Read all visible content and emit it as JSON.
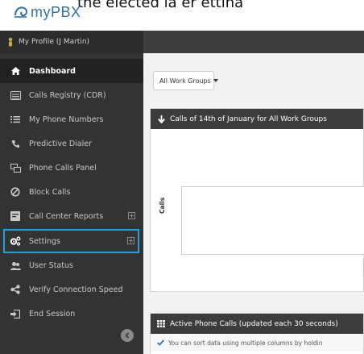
{
  "header": {
    "brand": "myPBX",
    "clipped_text": "the elected la er ettina"
  },
  "profile": {
    "label": "My Profile (J Martin)"
  },
  "sidebar": {
    "items": [
      {
        "label": "Dashboard",
        "icon": "home-icon",
        "active": true
      },
      {
        "label": "Calls Registry (CDR)",
        "icon": "registry-icon"
      },
      {
        "label": "My Phone Numbers",
        "icon": "list-icon"
      },
      {
        "label": "Predictive Dialer",
        "icon": "phone-icon"
      },
      {
        "label": "Phone Calls Panel",
        "icon": "panel-icon"
      },
      {
        "label": "Block Calls",
        "icon": "block-icon"
      },
      {
        "label": "Call Center Reports",
        "icon": "reports-icon",
        "expandable": true
      },
      {
        "label": "Settings",
        "icon": "gear-icon",
        "expandable": true,
        "highlighted": true
      },
      {
        "label": "User Status",
        "icon": "users-icon"
      },
      {
        "label": "Verify Connection Speed",
        "icon": "share-icon"
      },
      {
        "label": "End Session",
        "icon": "logout-icon"
      }
    ]
  },
  "main": {
    "workgroup_select": "All Work Groups",
    "calls_panel": {
      "title": "Calls of 14th of January for All Work Groups",
      "ylabel": "Calls"
    },
    "active_panel": {
      "title": "Active Phone Calls (updated each 30 seconds)",
      "info": "You can sort data using multiple columns by holdin"
    }
  },
  "colors": {
    "sidebar": "#333333",
    "header_dark": "#3d3d3d",
    "highlight": "#1aa3e0",
    "brand": "#2d71b5"
  }
}
